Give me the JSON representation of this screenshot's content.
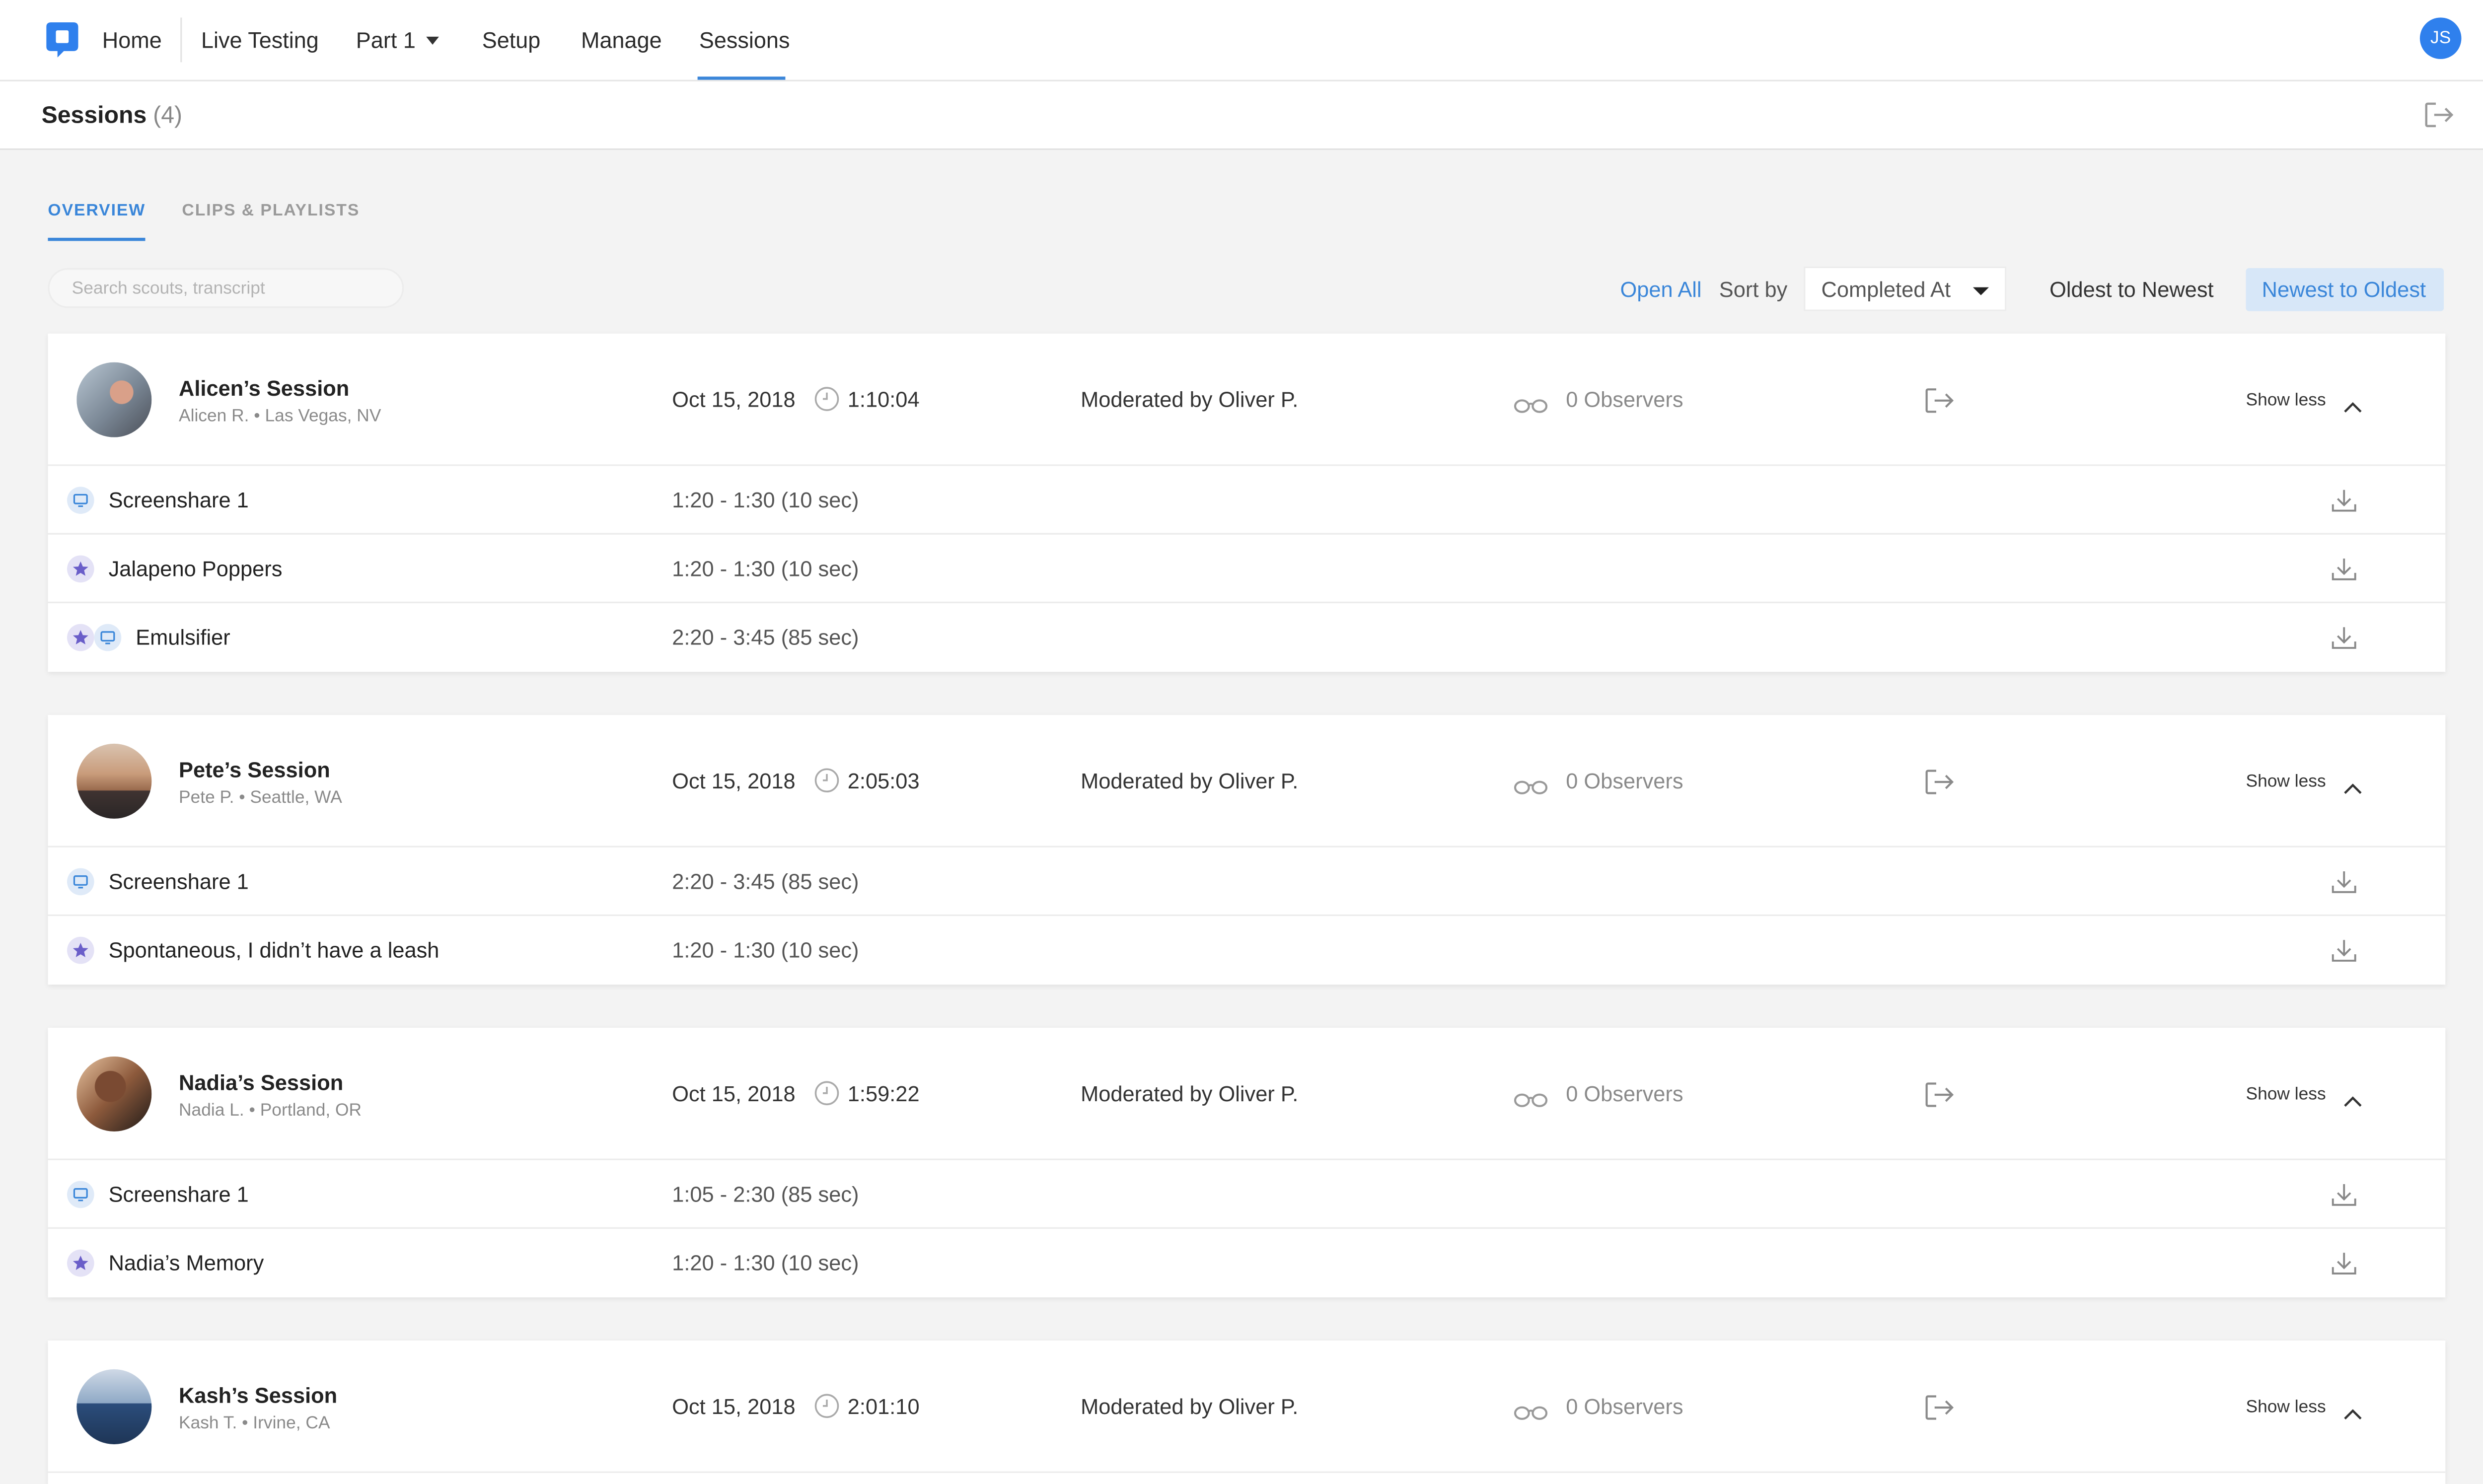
{
  "nav": {
    "items": [
      "Home",
      "Live Testing",
      "Part 1",
      "Setup",
      "Manage",
      "Sessions"
    ],
    "active": "Sessions",
    "user_initials": "JS",
    "accent": "#3a86d9"
  },
  "header": {
    "title": "Sessions",
    "count": "(4)"
  },
  "tabs": [
    "OVERVIEW",
    "CLIPS & PLAYLISTS"
  ],
  "toolbar": {
    "search_placeholder": "Search scouts, transcript",
    "open_all": "Open All",
    "sort_by": "Sort by",
    "sort_value": "Completed At",
    "oldest": "Oldest to Newest",
    "newest": "Newest to Oldest"
  },
  "sessions": [
    {
      "name": "Alicen’s Session",
      "location": "Alicen R. • Las Vegas, NV",
      "date": "Oct 15, 2018",
      "duration": "1:10:04",
      "moderator": "Moderated by Oliver P.",
      "observers": "0 Observers",
      "toggle": "Show less",
      "clips": [
        {
          "type": "screen",
          "name": "Screenshare 1",
          "range": "1:20 - 1:30 (10 sec)"
        },
        {
          "type": "star",
          "name": "Jalapeno Poppers",
          "range": "1:20 - 1:30 (10 sec)"
        },
        {
          "type": "both",
          "name": "Emulsifier",
          "range": "2:20 - 3:45 (85 sec)"
        }
      ]
    },
    {
      "name": "Pete’s Session",
      "location": "Pete P. • Seattle, WA",
      "date": "Oct 15, 2018",
      "duration": "2:05:03",
      "moderator": "Moderated by Oliver P.",
      "observers": "0 Observers",
      "toggle": "Show less",
      "clips": [
        {
          "type": "screen",
          "name": "Screenshare 1",
          "range": "2:20 - 3:45 (85 sec)"
        },
        {
          "type": "star",
          "name": "Spontaneous, I didn’t have a leash",
          "range": "1:20 - 1:30 (10 sec)"
        }
      ]
    },
    {
      "name": "Nadia’s Session",
      "location": "Nadia L. • Portland, OR",
      "date": "Oct 15, 2018",
      "duration": "1:59:22",
      "moderator": "Moderated by Oliver P.",
      "observers": "0 Observers",
      "toggle": "Show less",
      "clips": [
        {
          "type": "screen",
          "name": "Screenshare 1",
          "range": "1:05 - 2:30 (85 sec)"
        },
        {
          "type": "star",
          "name": "Nadia’s Memory",
          "range": "1:20 - 1:30 (10 sec)"
        }
      ]
    },
    {
      "name": "Kash’s Session",
      "location": "Kash T. • Irvine, CA",
      "date": "Oct 15, 2018",
      "duration": "2:01:10",
      "moderator": "Moderated by Oliver P.",
      "observers": "0 Observers",
      "toggle": "Show less",
      "clips": []
    }
  ]
}
